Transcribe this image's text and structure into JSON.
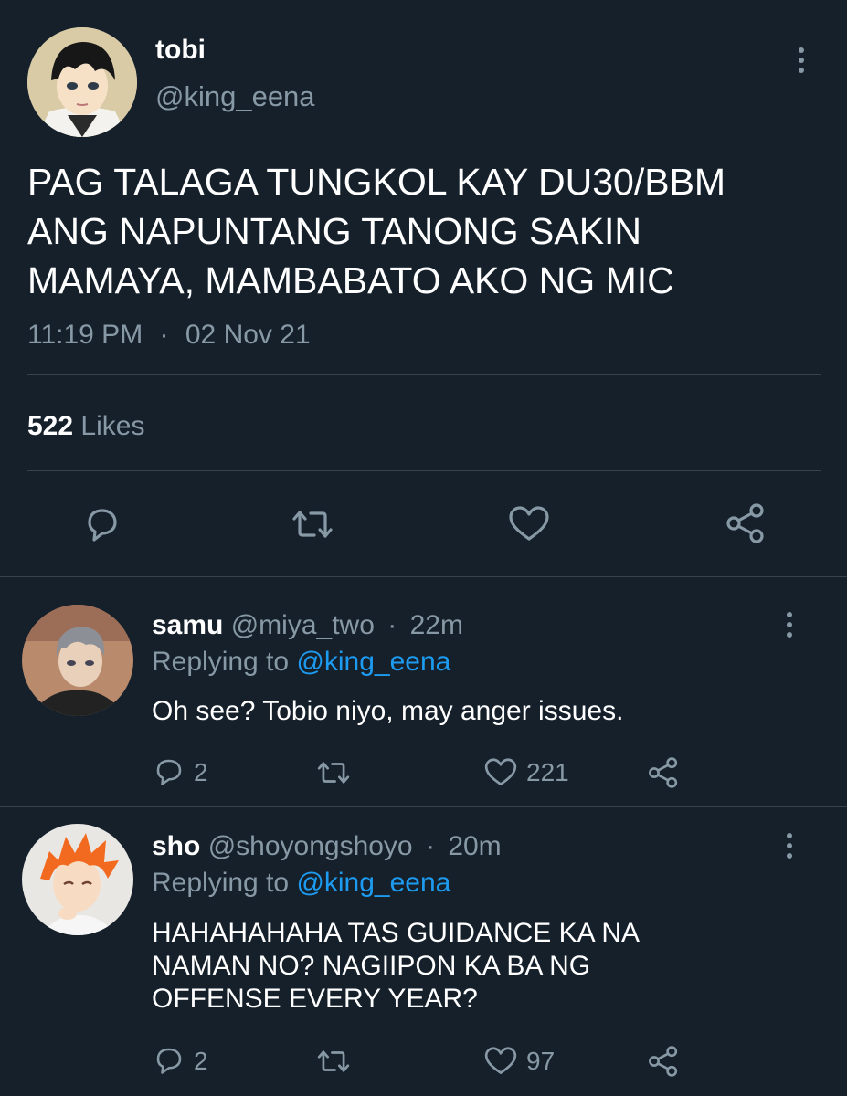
{
  "main_tweet": {
    "display_name": "tobi",
    "handle": "@king_eena",
    "text_lines": [
      "PAG TALAGA TUNGKOL KAY DU30/BBM",
      "ANG NAPUNTANG TANONG SAKIN",
      "MAMAYA, MAMBABATO AKO NG MIC"
    ],
    "time": "11:19 PM",
    "separator": "·",
    "date": "02 Nov 21",
    "likes_count": "522",
    "likes_label": "Likes"
  },
  "replies": [
    {
      "display_name": "samu",
      "handle": "@miya_two",
      "separator": "·",
      "age": "22m",
      "replying_prefix": "Replying to",
      "replying_to": "@king_eena",
      "text_lines": [
        "Oh see? Tobio niyo, may anger issues."
      ],
      "reply_count": "2",
      "like_count": "221"
    },
    {
      "display_name": "sho",
      "handle": "@shoyongshoyo",
      "separator": "·",
      "age": "20m",
      "replying_prefix": "Replying to",
      "replying_to": "@king_eena",
      "text_lines": [
        "HAHAHAHAHA TAS GUIDANCE KA NA",
        "NAMAN NO? NAGIIPON KA BA NG",
        "OFFENSE EVERY YEAR?"
      ],
      "reply_count": "2",
      "like_count": "97"
    }
  ],
  "icons": {
    "reply": "reply-icon",
    "retweet": "retweet-icon",
    "like": "heart-icon",
    "share": "share-icon",
    "more": "more-vertical-icon"
  },
  "colors": {
    "background": "#15202b",
    "text": "#ffffff",
    "muted": "#8899a6",
    "link": "#1d9bf0",
    "divider": "#38444d"
  }
}
